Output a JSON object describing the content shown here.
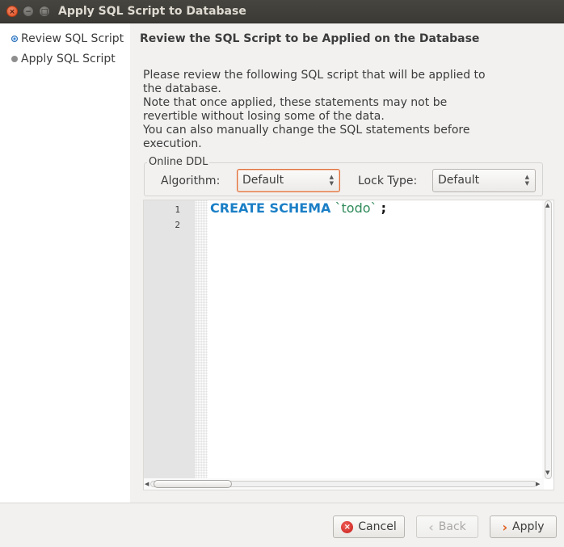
{
  "window": {
    "title": "Apply SQL Script to Database",
    "close_glyph": "×",
    "min_glyph": "−",
    "max_glyph": "□"
  },
  "sidebar": {
    "steps": [
      {
        "label": "Review SQL Script",
        "state": "active"
      },
      {
        "label": "Apply SQL Script",
        "state": "inactive"
      }
    ]
  },
  "main": {
    "heading": "Review the SQL Script to be Applied on the Database",
    "description_lines": [
      "Please review the following SQL script that will be applied to",
      "the database.",
      "Note that once applied, these statements may not be",
      "revertible without losing some of the data.",
      "You can also manually change the SQL statements before",
      "execution."
    ]
  },
  "online_ddl": {
    "group_label": "Online DDL",
    "algorithm_label": "Algorithm:",
    "algorithm_value": "Default",
    "lock_type_label": "Lock Type:",
    "lock_type_value": "Default"
  },
  "editor": {
    "line_numbers": [
      "1",
      "2"
    ],
    "code": {
      "keyword": "CREATE SCHEMA",
      "identifier": "`todo`",
      "terminator": ";"
    }
  },
  "buttons": {
    "cancel": "Cancel",
    "back": "Back",
    "apply": "Apply"
  },
  "colors": {
    "keyword": "#1b7fc6",
    "identifier": "#2f8a5a",
    "focus_border": "#e0703c",
    "active_step": "#3a86d4"
  },
  "icons": {
    "cancel": "cancel-icon",
    "back": "chevron-left-icon",
    "apply": "chevron-right-icon"
  }
}
